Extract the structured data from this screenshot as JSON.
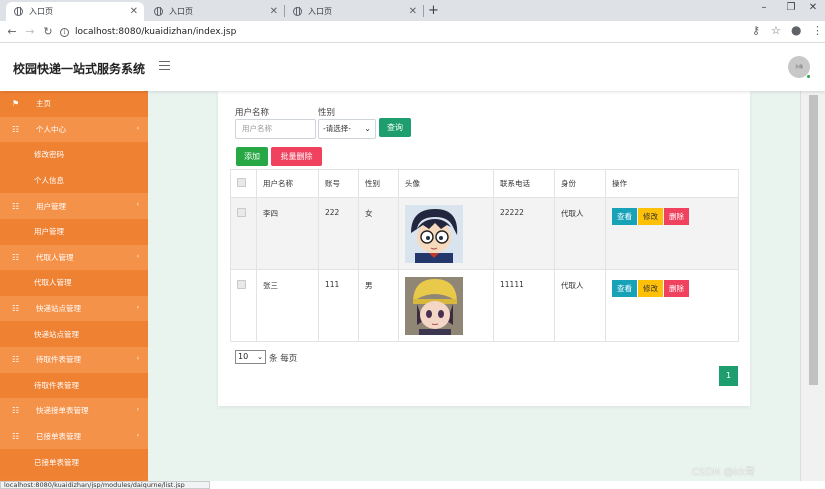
{
  "browser": {
    "tabs": [
      {
        "title": "入口页",
        "active": true
      },
      {
        "title": "入口页",
        "active": false
      },
      {
        "title": "入口页",
        "active": false
      }
    ],
    "url": "localhost:8080/kuaidizhan/index.jsp",
    "status_url": "localhost:8080/kuaidizhan/jsp/modules/daiqurne/list.jsp"
  },
  "header": {
    "title": "校园快递一站式服务系统",
    "avatar_text": "头像"
  },
  "sidebar": {
    "items": [
      {
        "label": "主页"
      },
      {
        "label": "个人中心"
      },
      {
        "label": "修改密码"
      },
      {
        "label": "个人信息"
      },
      {
        "label": "用户管理"
      },
      {
        "label": "用户管理"
      },
      {
        "label": "代取人管理"
      },
      {
        "label": "代取人管理"
      },
      {
        "label": "快递站点管理"
      },
      {
        "label": "快递站点管理"
      },
      {
        "label": "待取件表管理"
      },
      {
        "label": "待取件表管理"
      },
      {
        "label": "快递接单表管理"
      },
      {
        "label": "已接单表管理"
      },
      {
        "label": "已接单表管理"
      }
    ]
  },
  "search": {
    "username_label": "用户名称",
    "username_placeholder": "用户名称",
    "gender_label": "性别",
    "gender_selected": "-请选择-",
    "query_label": "查询"
  },
  "actions": {
    "add_label": "添加",
    "batch_delete_label": "批量删除"
  },
  "table": {
    "headers": [
      "用户名称",
      "账号",
      "性别",
      "头像",
      "联系电话",
      "身份",
      "操作"
    ],
    "rows": [
      {
        "name": "李四",
        "account": "222",
        "gender": "女",
        "phone": "22222",
        "role": "代取人"
      },
      {
        "name": "张三",
        "account": "111",
        "gender": "男",
        "phone": "11111",
        "role": "代取人"
      }
    ],
    "op_view": "查看",
    "op_edit": "修改",
    "op_delete": "删除"
  },
  "pagination": {
    "page_size": "10",
    "per_page_label": "条 每页",
    "current_page": "1"
  },
  "watermark": "CSDN @kk哥"
}
